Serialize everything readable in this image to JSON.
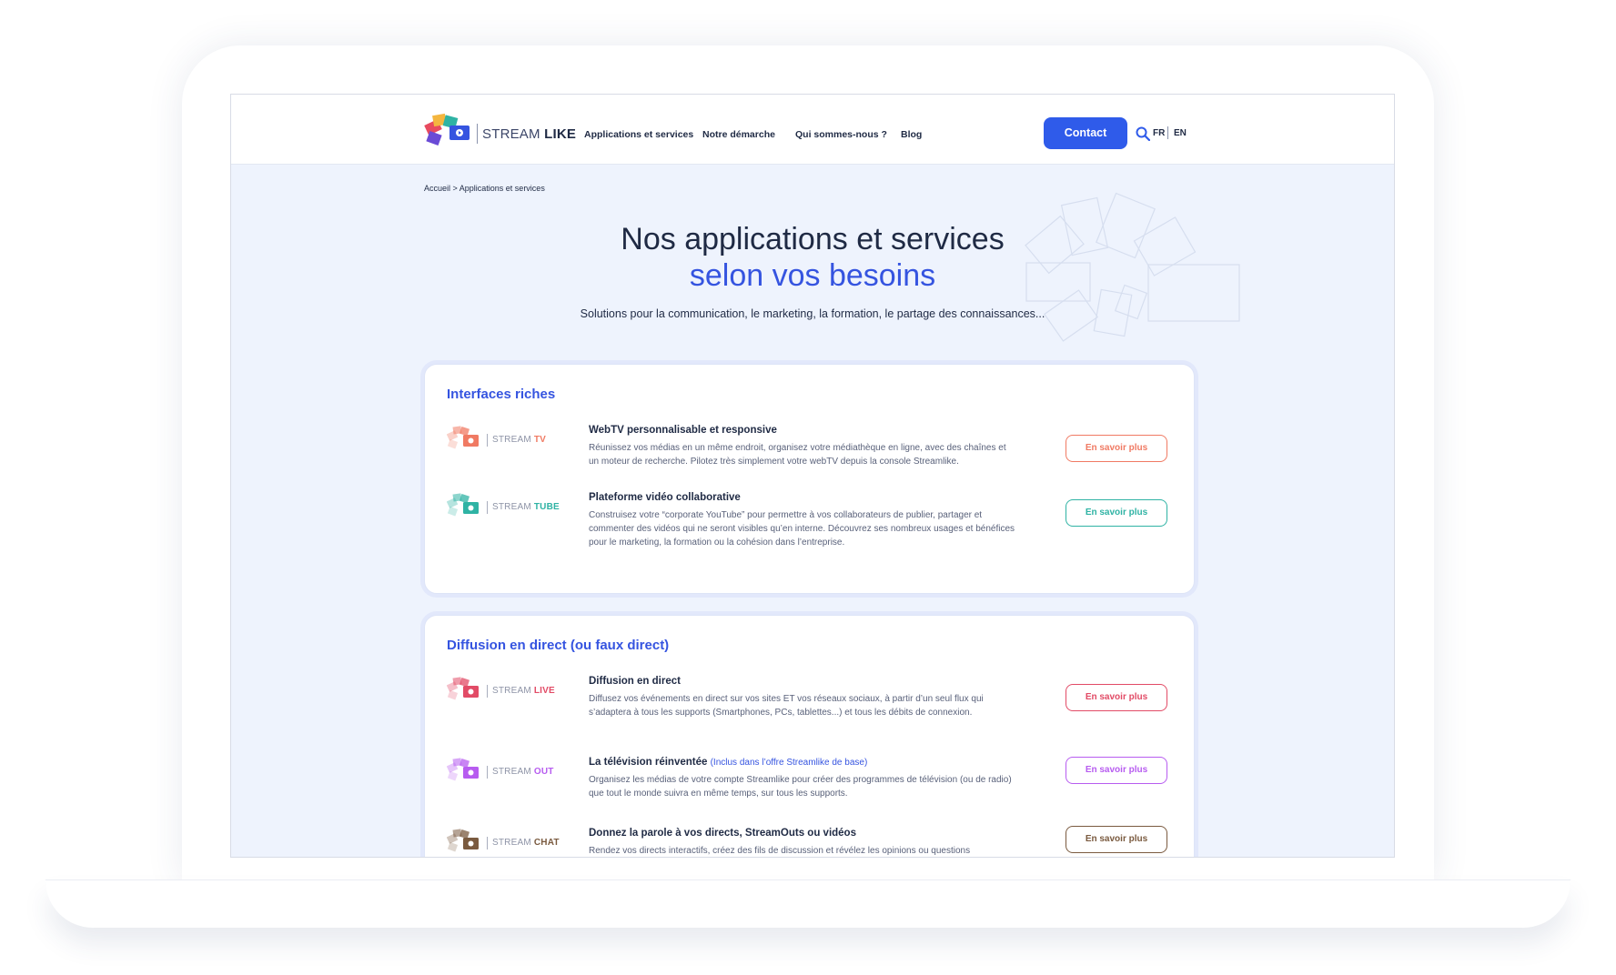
{
  "header": {
    "logo": {
      "word1": "STREAM",
      "word2": "LIKE"
    },
    "nav": [
      {
        "label": "Applications et services"
      },
      {
        "label": "Notre démarche"
      },
      {
        "label": "Qui sommes-nous ?"
      },
      {
        "label": "Blog"
      }
    ],
    "contact_label": "Contact",
    "lang_fr": "FR",
    "lang_en": "EN"
  },
  "breadcrumb": "Accueil > Applications et services",
  "hero": {
    "title_line1": "Nos applications et services",
    "title_line2": "selon vos besoins",
    "subtitle": "Solutions pour la communication, le marketing, la formation, le partage des connaissances..."
  },
  "sections": [
    {
      "title": "Interfaces riches",
      "services": [
        {
          "brand_prefix": "STREAM",
          "brand_suffix": "TV",
          "color": "#f07a63",
          "title": "WebTV personnalisable et responsive",
          "desc": "Réunissez vos médias en un même endroit, organisez votre médiathèque en ligne, avec des chaînes et un moteur de recherche. Pilotez très simplement votre webTV depuis la console Streamlike.",
          "cta": "En savoir plus"
        },
        {
          "brand_prefix": "STREAM",
          "brand_suffix": "TUBE",
          "color": "#2fb3a4",
          "title": "Plateforme vidéo collaborative",
          "desc": "Construisez votre “corporate YouTube” pour permettre à vos collaborateurs de publier, partager et commenter des vidéos qui ne seront visibles qu’en interne. Découvrez ses nombreux usages et bénéfices pour le marketing, la formation ou la cohésion dans l’entreprise.",
          "cta": "En savoir plus"
        }
      ]
    },
    {
      "title": "Diffusion en direct (ou faux direct)",
      "services": [
        {
          "brand_prefix": "STREAM",
          "brand_suffix": "LIVE",
          "color": "#e24b66",
          "title": "Diffusion en direct",
          "desc": "Diffusez vos événements en direct sur vos sites ET vos réseaux sociaux, à partir d’un seul flux qui s’adaptera à tous les supports (Smartphones, PCs, tablettes...) et tous les débits de connexion.",
          "cta": "En savoir plus"
        },
        {
          "brand_prefix": "STREAM",
          "brand_suffix": "OUT",
          "color": "#b75cf0",
          "title": "La télévision réinventée",
          "tag": "(Inclus dans l’offre Streamlike de base)",
          "desc": "Organisez les médias de votre compte Streamlike pour créer des programmes de télévision (ou de radio) que tout le monde suivra en même temps, sur tous les supports.",
          "cta": "En savoir plus"
        },
        {
          "brand_prefix": "STREAM",
          "brand_suffix": "CHAT",
          "color": "#7a5a3f",
          "title": "Donnez la parole à vos directs, StreamOuts ou vidéos",
          "desc": "Rendez vos directs interactifs, créez des fils de discussion et révélez les opinions ou questions",
          "cta": "En savoir plus"
        }
      ]
    }
  ]
}
